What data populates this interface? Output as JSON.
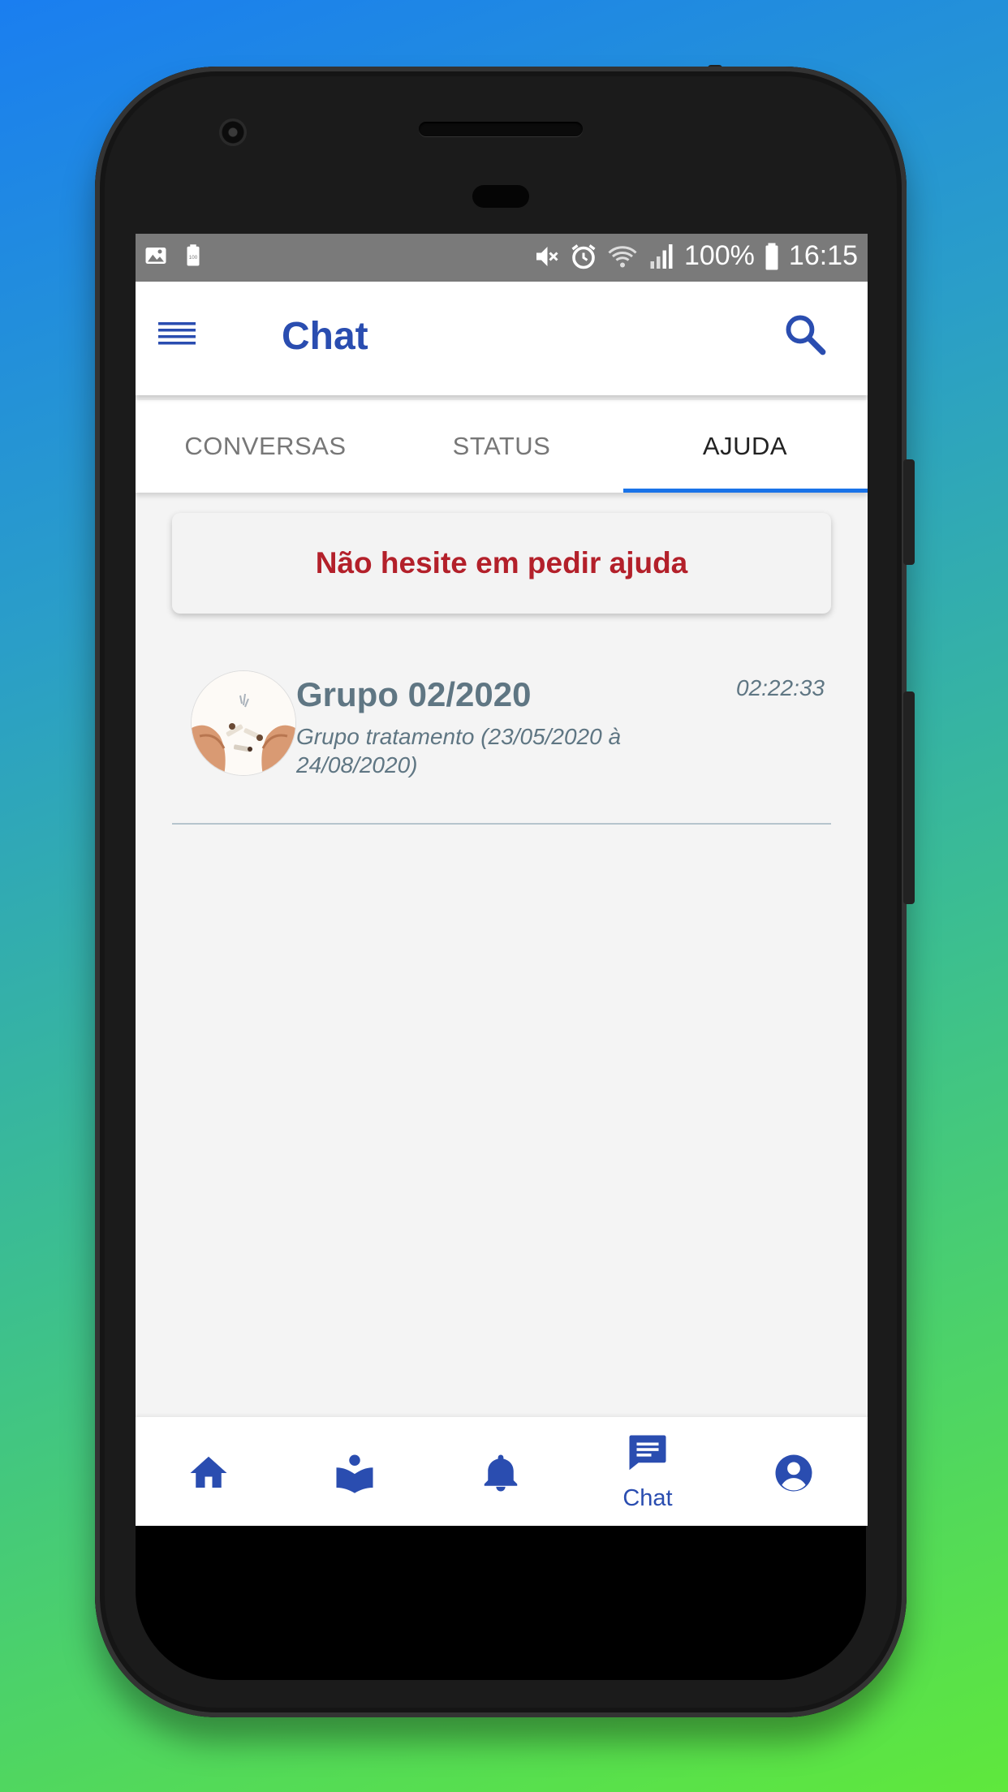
{
  "status_bar": {
    "battery_percent": "100%",
    "time": "16:15"
  },
  "app_bar": {
    "title": "Chat"
  },
  "tabs": [
    {
      "label": "CONVERSAS",
      "active": false
    },
    {
      "label": "STATUS",
      "active": false
    },
    {
      "label": "AJUDA",
      "active": true
    }
  ],
  "help_banner": {
    "text": "Não hesite em pedir ajuda"
  },
  "chats": [
    {
      "name": "Grupo 02/2020",
      "description": "Grupo tratamento (23/05/2020 à 24/08/2020)",
      "time": "02:22:33"
    }
  ],
  "bottom_nav": [
    {
      "icon": "home-icon",
      "label": ""
    },
    {
      "icon": "reader-icon",
      "label": ""
    },
    {
      "icon": "bell-icon",
      "label": ""
    },
    {
      "icon": "chat-icon",
      "label": "Chat",
      "active": true
    },
    {
      "icon": "account-icon",
      "label": ""
    }
  ],
  "colors": {
    "primary": "#2a4db0",
    "tab_indicator": "#1a73e8",
    "help_text": "#b3202a",
    "chat_text": "#5f7683"
  }
}
